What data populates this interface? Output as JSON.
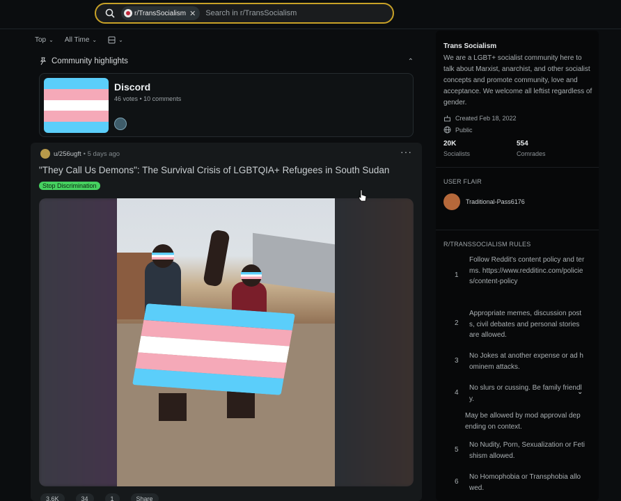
{
  "search": {
    "chip": "r/TransSocialism",
    "placeholder": "Search in r/TransSocialism"
  },
  "sort": {
    "top": "Top",
    "time": "All Time"
  },
  "highlights": {
    "heading": "Community highlights",
    "card_title": "Discord",
    "card_meta": "46 votes • 10 comments"
  },
  "post": {
    "user": "u/256ugft",
    "time": "• 5 days ago",
    "title": "\"They Call Us Demons\": The Survival Crisis of LGBTQIA+ Refugees in South Sudan",
    "flair": "Stop Discrimination",
    "actions": [
      "3.6K",
      "34",
      "1",
      "Share"
    ]
  },
  "sidebar": {
    "title": "Trans Socialism",
    "description": "We are a LGBT+ socialist community here to talk about Marxist, anarchist, and other socialist concepts and promote community, love and acceptance. We welcome all leftist regardless of gender.",
    "created": "Created Feb 18, 2022",
    "visibility": "Public",
    "members": "20K",
    "members_label": "Socialists",
    "online": "554",
    "online_label": "Comrades",
    "user_flair_heading": "USER FLAIR",
    "user_flair_name": "Traditional-Pass6176",
    "rules_heading": "R/TRANSSOCIALISM RULES",
    "rules": [
      {
        "num": "1",
        "text": "Follow Reddit's content policy and terms. https://www.redditinc.com/policies/content-policy"
      },
      {
        "num": "2",
        "text": "Appropriate memes, discussion posts, civil debates and personal stories are allowed."
      },
      {
        "num": "3",
        "text": "No Jokes at another expense or ad hominem attacks."
      },
      {
        "num": "4",
        "text": "No slurs or cussing. Be family friendly."
      },
      {
        "num": "",
        "text": "May be allowed by mod approval depending on context."
      },
      {
        "num": "5",
        "text": "No Nudity, Porn, Sexualization or Fetishism allowed."
      },
      {
        "num": "6",
        "text": "No Homophobia or Transphobia allowed."
      }
    ]
  },
  "colors": {
    "search_border": "#c9a227",
    "flair_bg": "#46d160",
    "trans_blue": "#5bcefa",
    "trans_pink": "#f5a9b8"
  }
}
